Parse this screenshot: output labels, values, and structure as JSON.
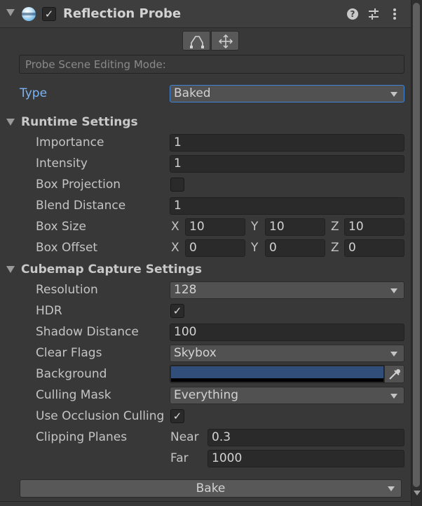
{
  "component": {
    "title": "Reflection Probe",
    "enabled_check": "✓",
    "help_glyph": "?",
    "edit_mode_label": "Probe Scene Editing Mode:"
  },
  "type": {
    "label": "Type",
    "value": "Baked"
  },
  "runtime": {
    "section": "Runtime Settings",
    "importance": {
      "label": "Importance",
      "value": "1"
    },
    "intensity": {
      "label": "Intensity",
      "value": "1"
    },
    "box_projection": {
      "label": "Box Projection"
    },
    "blend_distance": {
      "label": "Blend Distance",
      "value": "1"
    },
    "box_size": {
      "label": "Box Size",
      "x_label": "X",
      "x": "10",
      "y_label": "Y",
      "y": "10",
      "z_label": "Z",
      "z": "10"
    },
    "box_offset": {
      "label": "Box Offset",
      "x_label": "X",
      "x": "0",
      "y_label": "Y",
      "y": "0",
      "z_label": "Z",
      "z": "0"
    }
  },
  "cubemap": {
    "section": "Cubemap Capture Settings",
    "resolution": {
      "label": "Resolution",
      "value": "128"
    },
    "hdr": {
      "label": "HDR",
      "check": "✓"
    },
    "shadow_distance": {
      "label": "Shadow Distance",
      "value": "100"
    },
    "clear_flags": {
      "label": "Clear Flags",
      "value": "Skybox"
    },
    "background": {
      "label": "Background",
      "color": "#314d79"
    },
    "culling_mask": {
      "label": "Culling Mask",
      "value": "Everything"
    },
    "occlusion": {
      "label": "Use Occlusion Culling",
      "check": "✓"
    },
    "clipping": {
      "label": "Clipping Planes",
      "near_label": "Near",
      "near": "0.3",
      "far_label": "Far",
      "far": "1000"
    }
  },
  "bake": {
    "label": "Bake"
  }
}
